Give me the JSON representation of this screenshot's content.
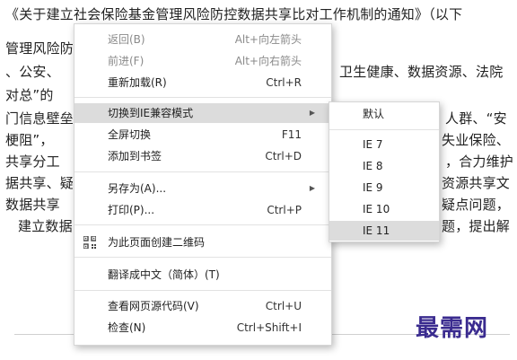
{
  "document": {
    "lines": [
      "《关于建立社会保险基金管理风险防控数据共享比对工作机制的通知》（以下",
      "管理风险防",
      "、公安、",
      "卫生健康、数据资源、法院",
      "对总”的",
      "门信息壁垒",
      "人群、“安",
      "梗阻”，",
      "失业保险、",
      "共享分工",
      "，合力维护",
      "据共享、疑",
      "资源共享文",
      "数据共享",
      "疑点问题，",
      "建立数据",
      "题，提出解"
    ]
  },
  "watermark": "最需网",
  "context_menu": {
    "items": [
      {
        "label": "返回(B)",
        "shortcut": "Alt+向左箭头"
      },
      {
        "label": "前进(F)",
        "shortcut": "Alt+向右箭头"
      },
      {
        "label": "重新加载(R)",
        "shortcut": "Ctrl+R"
      },
      {
        "label": "切换到IE兼容模式",
        "shortcut": ""
      },
      {
        "label": "全屏切换",
        "shortcut": "F11"
      },
      {
        "label": "添加到书签",
        "shortcut": "Ctrl+D"
      },
      {
        "label": "另存为(A)...",
        "shortcut": ""
      },
      {
        "label": "打印(P)...",
        "shortcut": "Ctrl+P"
      },
      {
        "label": "为此页面创建二维码",
        "shortcut": ""
      },
      {
        "label": "翻译成中文（简体）(T)",
        "shortcut": ""
      },
      {
        "label": "查看网页源代码(V)",
        "shortcut": "Ctrl+U"
      },
      {
        "label": "检查(N)",
        "shortcut": "Ctrl+Shift+I"
      }
    ]
  },
  "submenu": {
    "items": [
      "默认",
      "IE 7",
      "IE 8",
      "IE 9",
      "IE 10",
      "IE 11"
    ]
  },
  "icons": {
    "qr": "qr-code-icon",
    "submenu_arrow": "chevron-right-icon"
  }
}
